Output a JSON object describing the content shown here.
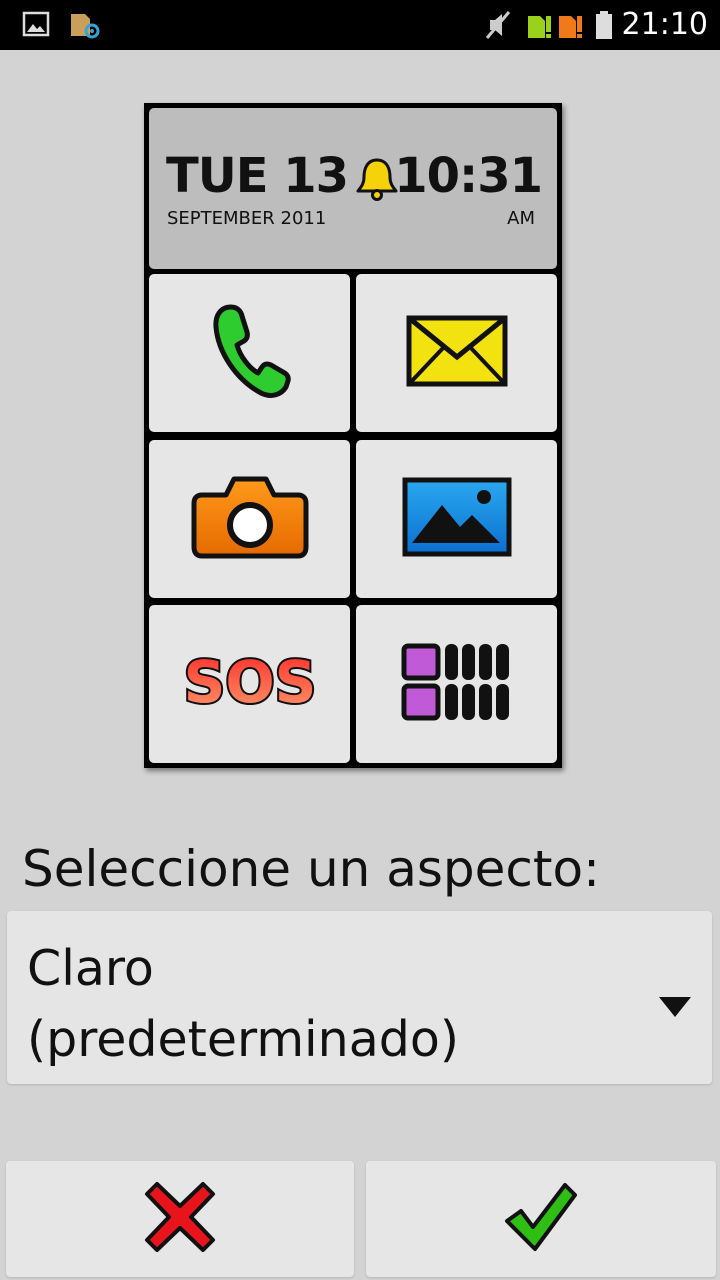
{
  "status_bar": {
    "time": "21:10",
    "icons": [
      "gallery-icon",
      "sd-card-settings-icon",
      "mute-icon",
      "sim1-signal-icon",
      "sim2-signal-icon",
      "battery-icon"
    ]
  },
  "preview": {
    "day": "TUE 13",
    "month_year": "SEPTEMBER 2011",
    "time": "10:31",
    "ampm": "AM",
    "sos_text": "SOS",
    "tiles": [
      "phone-icon",
      "message-icon",
      "camera-icon",
      "gallery-icon",
      "sos-icon",
      "apps-icon"
    ]
  },
  "theme_selector": {
    "label": "Seleccione un aspecto:",
    "value_line1": "Claro",
    "value_line2": "(predeterminado)"
  },
  "actions": {
    "cancel_icon": "red-x-icon",
    "confirm_icon": "green-check-icon"
  },
  "colors": {
    "background": "#d3d3d3",
    "status_bar": "#000000",
    "tile": "#e6e6e6",
    "header": "#bdbdbd",
    "cancel": "#e8141c",
    "confirm": "#2fbf14"
  }
}
